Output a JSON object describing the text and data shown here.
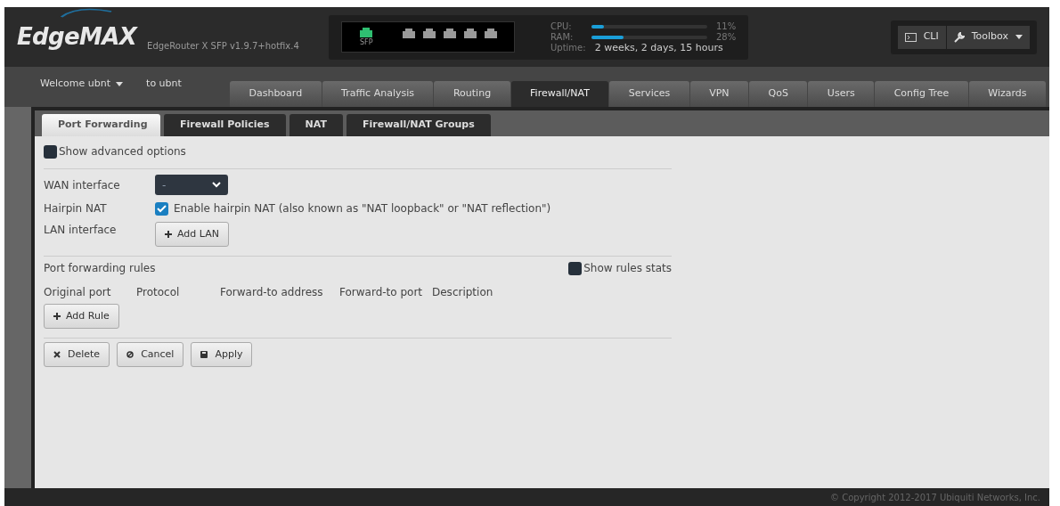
{
  "header": {
    "logo": "EdgeMAX",
    "version": "EdgeRouter X SFP v1.9.7+hotfix.4",
    "ports": [
      {
        "label": "SFP",
        "active": true
      },
      {
        "active": false
      },
      {
        "active": false
      },
      {
        "active": false
      },
      {
        "active": false
      },
      {
        "active": false
      }
    ],
    "meters": [
      {
        "label": "CPU:",
        "level": 0.11,
        "reading": "11%"
      },
      {
        "label": "RAM:",
        "level": 0.28,
        "reading": "28%"
      }
    ],
    "uptime": {
      "label": "Uptime:",
      "value": "2 weeks, 2 days, 15 hours"
    },
    "buttons": [
      {
        "label": "CLI",
        "kind": "cli"
      },
      {
        "label": "Toolbox",
        "kind": "menu"
      }
    ]
  },
  "nav": {
    "user_menu": "Welcome ubnt",
    "user_text": "to ubnt",
    "tabs": [
      {
        "label": "Dashboard",
        "selected": false
      },
      {
        "label": "Traffic Analysis",
        "selected": false
      },
      {
        "label": "Routing",
        "selected": false
      },
      {
        "label": "Firewall/NAT",
        "selected": true
      },
      {
        "label": "Services",
        "selected": false
      },
      {
        "label": "VPN",
        "selected": false
      },
      {
        "label": "QoS",
        "selected": false
      },
      {
        "label": "Users",
        "selected": false
      },
      {
        "label": "Config Tree",
        "selected": false
      },
      {
        "label": "Wizards",
        "selected": false
      }
    ]
  },
  "subtabs": [
    {
      "label": "Port Forwarding",
      "selected": true
    },
    {
      "label": "Firewall Policies",
      "selected": false
    },
    {
      "label": "NAT",
      "selected": false
    },
    {
      "label": "Firewall/NAT Groups",
      "selected": false
    }
  ],
  "advanced": {
    "label": "Show advanced options",
    "checked": false
  },
  "wan": {
    "label": "WAN interface",
    "value": "-"
  },
  "hairpin": {
    "label": "Hairpin NAT",
    "option": "Enable hairpin NAT (also known as \"NAT loopback\" or \"NAT reflection\")",
    "checked": true
  },
  "lan": {
    "label": "LAN interface",
    "button": "Add LAN"
  },
  "rules": {
    "title": "Port forwarding rules",
    "stats": {
      "label": "Show rules stats",
      "checked": false
    },
    "columns": [
      "Original port",
      "Protocol",
      "Forward-to address",
      "Forward-to port",
      "Description"
    ],
    "add_button": "Add Rule"
  },
  "actions": [
    {
      "label": "Delete",
      "kind": "delete"
    },
    {
      "label": "Cancel",
      "kind": "cancel"
    },
    {
      "label": "Apply",
      "kind": "apply"
    }
  ],
  "footer": "© Copyright 2012-2017 Ubiquiti Networks, Inc."
}
